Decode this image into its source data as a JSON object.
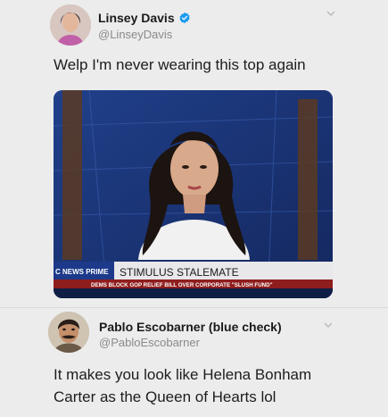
{
  "tweet1": {
    "author_name": "Linsey Davis",
    "handle": "@LinseyDavis",
    "text": "Welp I'm never wearing this top again",
    "media": {
      "network_label": "C NEWS PRIME",
      "headline": "STIMULUS STALEMATE",
      "ticker": "DEMS BLOCK GOP RELIEF BILL OVER CORPORATE \"SLUSH FUND\""
    }
  },
  "tweet2": {
    "author_name": "Pablo Escobarner (blue check)",
    "handle": "@PabloEscobarner",
    "text": "It makes you look like Helena Bonham Carter as the Queen of Hearts lol"
  },
  "colors": {
    "verified": "#1d9bf0",
    "handle": "#8a8a8a",
    "background": "#ececec"
  },
  "icons": [
    "verified-badge-icon",
    "chevron-down-icon"
  ]
}
